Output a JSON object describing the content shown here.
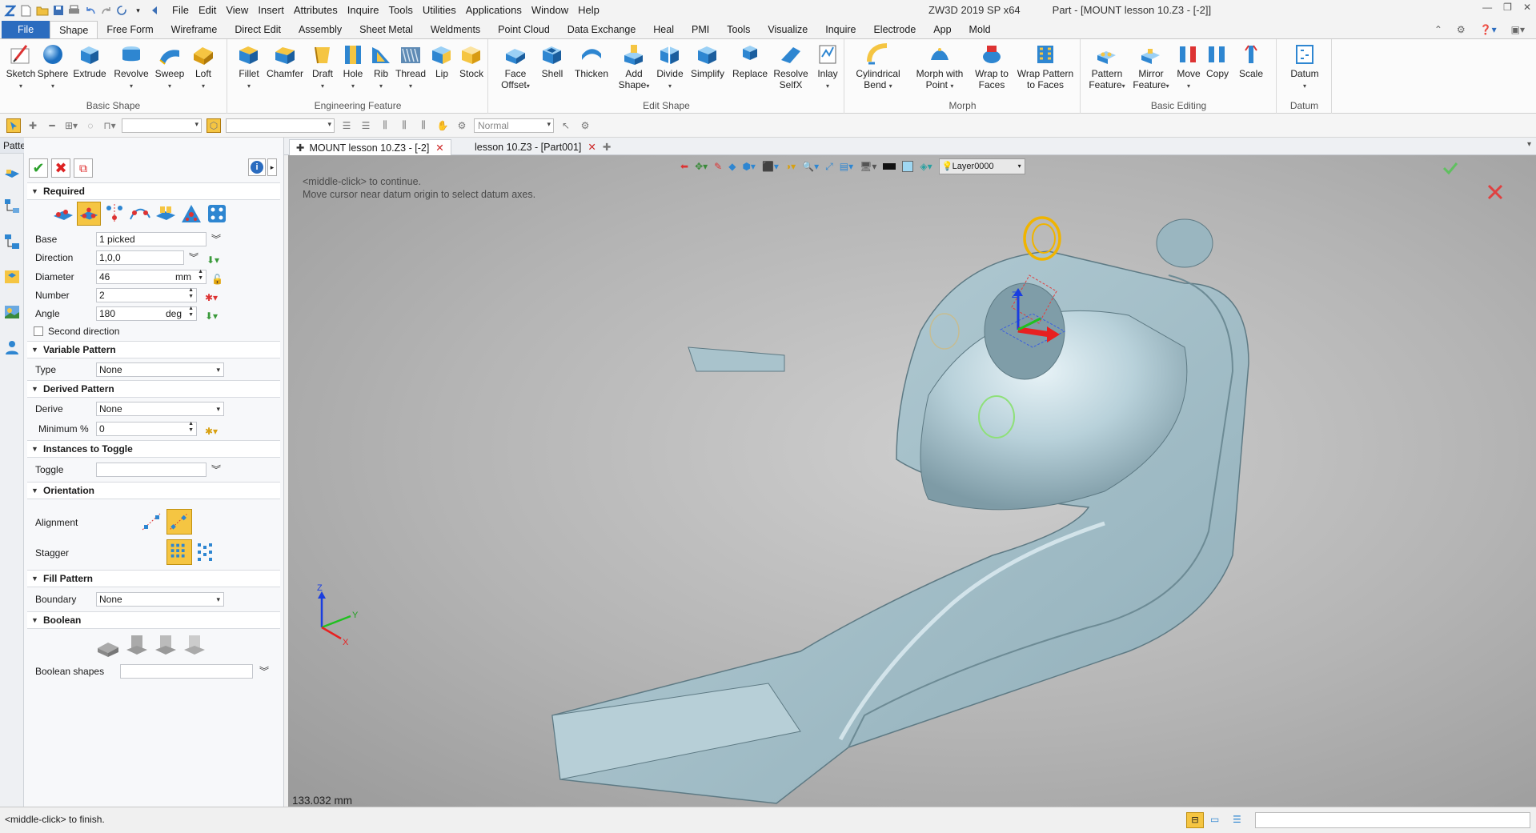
{
  "titlebar": {
    "menus": [
      "File",
      "Edit",
      "View",
      "Insert",
      "Attributes",
      "Inquire",
      "Tools",
      "Utilities",
      "Applications",
      "Window",
      "Help"
    ],
    "app_title": "ZW3D 2019 SP x64",
    "doc_title": "Part - [MOUNT lesson 10.Z3 - [-2]]"
  },
  "ribbon_tabs": [
    "File",
    "Shape",
    "Free Form",
    "Wireframe",
    "Direct Edit",
    "Assembly",
    "Sheet Metal",
    "Weldments",
    "Point Cloud",
    "Data Exchange",
    "Heal",
    "PMI",
    "Tools",
    "Visualize",
    "Inquire",
    "Electrode",
    "App",
    "Mold"
  ],
  "active_tab": "Shape",
  "ribbon": {
    "basic_shape": {
      "label": "Basic Shape",
      "buttons": [
        "Sketch",
        "Sphere",
        "Extrude",
        "Revolve",
        "Sweep",
        "Loft"
      ]
    },
    "engineering_feature": {
      "label": "Engineering Feature",
      "buttons": [
        "Fillet",
        "Chamfer",
        "Draft",
        "Hole",
        "Rib",
        "Thread",
        "Lip",
        "Stock"
      ]
    },
    "edit_shape": {
      "label": "Edit Shape",
      "buttons": [
        [
          "Face",
          "Offset"
        ],
        [
          "Shell",
          ""
        ],
        [
          "Thicken",
          ""
        ],
        [
          "Add",
          "Shape"
        ],
        [
          "Divide",
          ""
        ],
        [
          "Simplify",
          ""
        ],
        [
          "Replace",
          ""
        ],
        [
          "Resolve",
          "SelfX"
        ],
        [
          "Inlay",
          ""
        ]
      ]
    },
    "morph": {
      "label": "Morph",
      "buttons": [
        [
          "Cylindrical",
          "Bend"
        ],
        [
          "Morph with",
          "Point"
        ],
        [
          "Wrap to",
          "Faces"
        ],
        [
          "Wrap Pattern",
          "to Faces"
        ]
      ]
    },
    "basic_editing": {
      "label": "Basic Editing",
      "buttons": [
        [
          "Pattern",
          "Feature"
        ],
        [
          "Mirror",
          "Feature"
        ],
        [
          "Move",
          ""
        ],
        [
          "Copy",
          ""
        ],
        [
          "Scale",
          ""
        ]
      ]
    },
    "datum": {
      "label": "Datum",
      "buttons": [
        "Datum"
      ]
    }
  },
  "toolbar": {
    "render_mode": "Normal"
  },
  "panel": {
    "title": "Pattern Feature",
    "required": {
      "label": "Required",
      "base_label": "Base",
      "base_value": "1 picked",
      "direction_label": "Direction",
      "direction_value": "1,0,0",
      "diameter_label": "Diameter",
      "diameter_value": "46",
      "diameter_unit": "mm",
      "number_label": "Number",
      "number_value": "2",
      "angle_label": "Angle",
      "angle_value": "180",
      "angle_unit": "deg",
      "second_direction": "Second direction"
    },
    "variable_pattern": {
      "label": "Variable Pattern",
      "type_label": "Type",
      "type_value": "None"
    },
    "derived_pattern": {
      "label": "Derived Pattern",
      "derive_label": "Derive",
      "derive_value": "None",
      "minimum_label": "Minimum %",
      "minimum_value": "0"
    },
    "instances": {
      "label": "Instances to Toggle",
      "toggle_label": "Toggle"
    },
    "orientation": {
      "label": "Orientation",
      "alignment_label": "Alignment",
      "stagger_label": "Stagger"
    },
    "fill_pattern": {
      "label": "Fill Pattern",
      "boundary_label": "Boundary",
      "boundary_value": "None"
    },
    "boolean": {
      "label": "Boolean",
      "shapes_label": "Boolean shapes"
    }
  },
  "doc_tabs": [
    "MOUNT lesson 10.Z3 - [-2]",
    "lesson 10.Z3 - [Part001]"
  ],
  "viewport": {
    "hint1": "<middle-click> to continue.",
    "hint2": "Move cursor near datum origin to select datum axes.",
    "layer": "Layer0000",
    "measure": "133.032 mm",
    "axis_x": "X",
    "axis_y": "Y",
    "axis_z": "Z"
  },
  "status": {
    "message": "<middle-click> to finish."
  },
  "colors": {
    "accent": "#2b6cbf",
    "model": "#a9c3cc",
    "viewport_bg": "#b4b4b4",
    "selection": "#f0b400"
  }
}
